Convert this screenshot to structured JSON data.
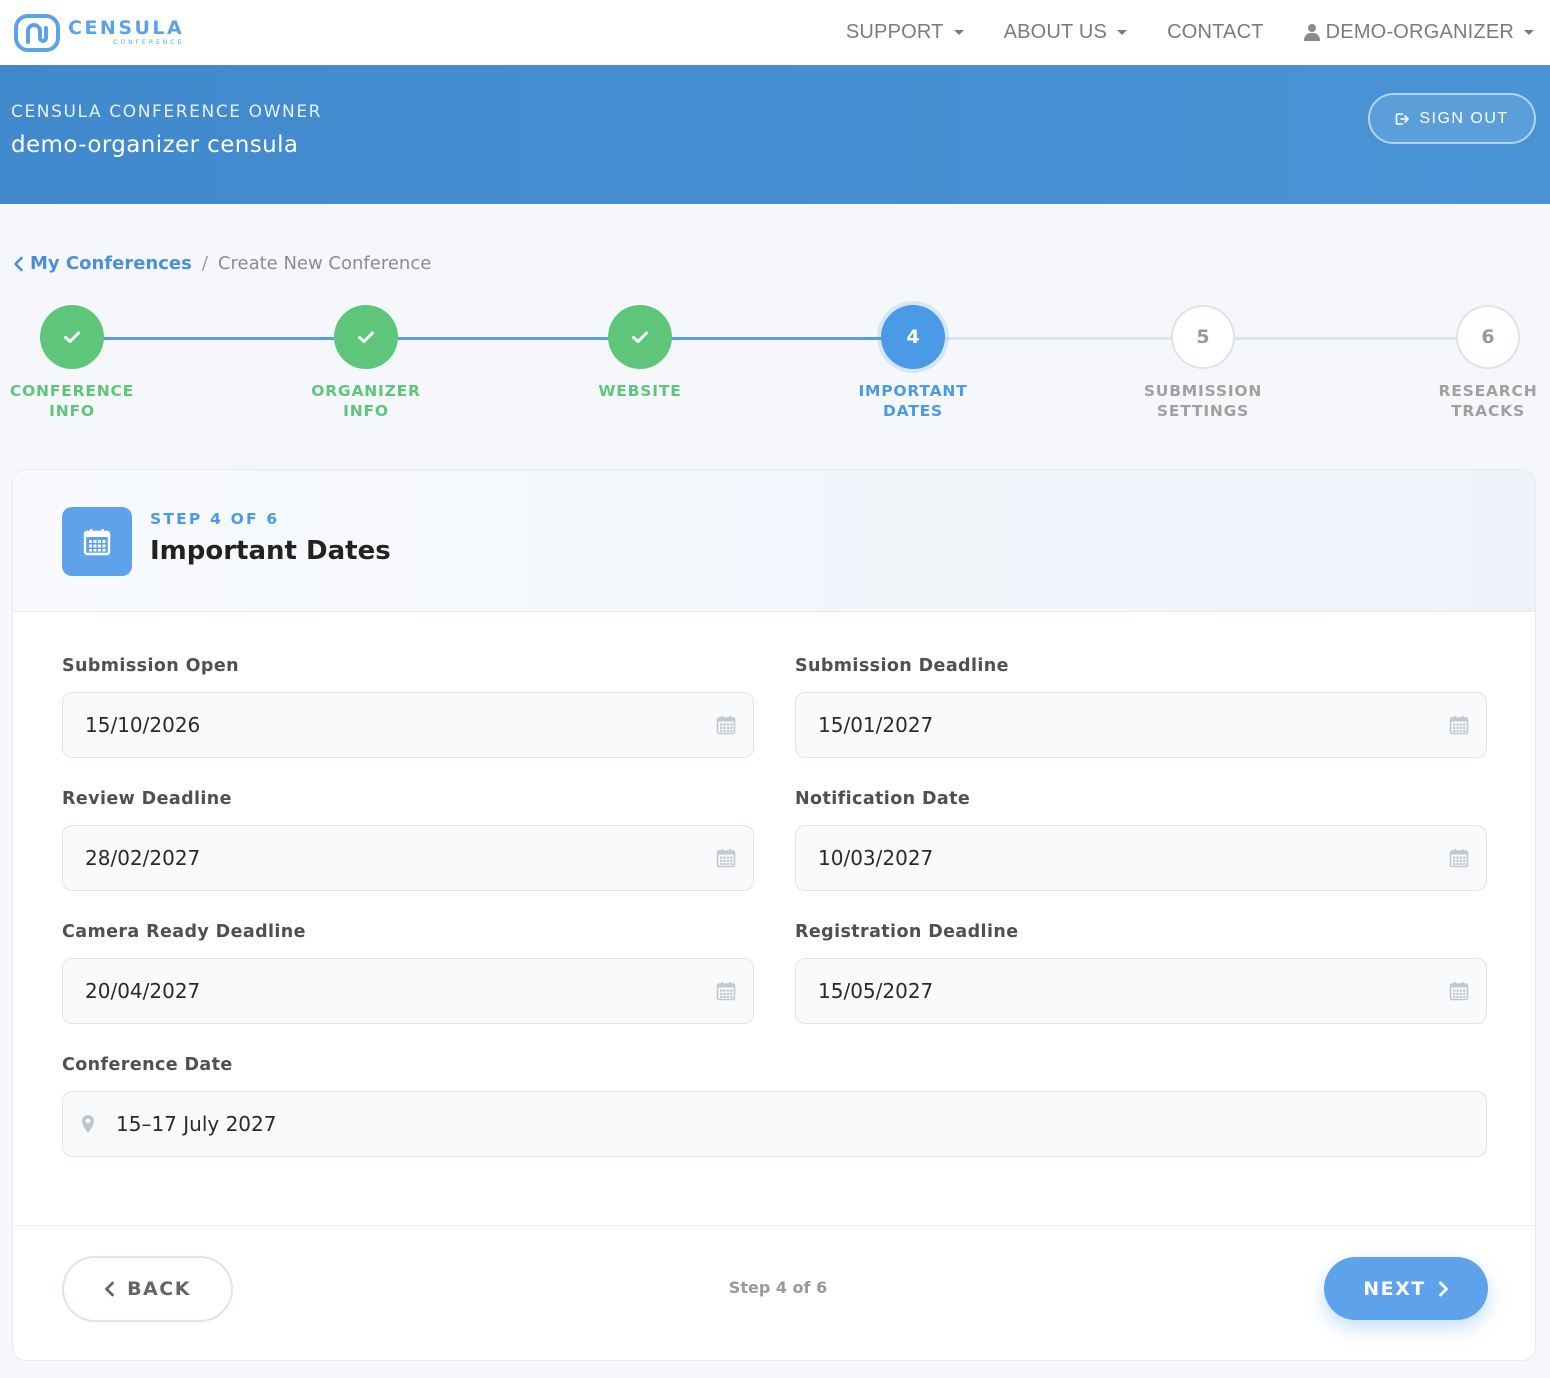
{
  "brand": {
    "name": "CENSULA",
    "tagline": "CONFERENCE",
    "logo_icon": "censula-logo-icon",
    "accent_color": "#5aa3e8"
  },
  "nav": {
    "items": [
      {
        "label": "SUPPORT",
        "has_dropdown": true
      },
      {
        "label": "ABOUT US",
        "has_dropdown": true
      },
      {
        "label": "CONTACT",
        "has_dropdown": false
      }
    ],
    "user": {
      "label": "DEMO-ORGANIZER",
      "icon": "user-icon",
      "has_dropdown": true
    }
  },
  "banner": {
    "role": "CENSULA CONFERENCE OWNER",
    "user_name": "demo-organizer censula",
    "sign_out_label": "SIGN OUT",
    "background_color": "#4189cd"
  },
  "breadcrumb": {
    "back_label": "My Conferences",
    "separator": "/",
    "current": "Create New Conference"
  },
  "stepper": {
    "current_step": 4,
    "total_steps": 6,
    "done_color": "#5ec67a",
    "active_color": "#4a9ae5",
    "steps": [
      {
        "number": "1",
        "line1": "CONFERENCE",
        "line2": "INFO",
        "state": "done"
      },
      {
        "number": "2",
        "line1": "ORGANIZER",
        "line2": "INFO",
        "state": "done"
      },
      {
        "number": "3",
        "line1": "WEBSITE",
        "line2": "",
        "state": "done"
      },
      {
        "number": "4",
        "line1": "IMPORTANT",
        "line2": "DATES",
        "state": "active"
      },
      {
        "number": "5",
        "line1": "SUBMISSION",
        "line2": "SETTINGS",
        "state": "todo"
      },
      {
        "number": "6",
        "line1": "RESEARCH",
        "line2": "TRACKS",
        "state": "todo"
      }
    ]
  },
  "card": {
    "step_label": "STEP 4 OF 6",
    "title": "Important Dates",
    "icon": "calendar-icon"
  },
  "form": {
    "submission_open": {
      "label": "Submission Open",
      "value": "15/10/2026",
      "icon": "calendar-icon"
    },
    "submission_deadline": {
      "label": "Submission Deadline",
      "value": "15/01/2027",
      "icon": "calendar-icon"
    },
    "review_deadline": {
      "label": "Review Deadline",
      "value": "28/02/2027",
      "icon": "calendar-icon"
    },
    "notification_date": {
      "label": "Notification Date",
      "value": "10/03/2027",
      "icon": "calendar-icon"
    },
    "camera_ready_deadline": {
      "label": "Camera Ready Deadline",
      "value": "20/04/2027",
      "icon": "calendar-icon"
    },
    "registration_deadline": {
      "label": "Registration Deadline",
      "value": "15/05/2027",
      "icon": "calendar-icon"
    },
    "conference_date": {
      "label": "Conference Date",
      "value": "15–17 July 2027",
      "icon": "location-pin-icon"
    }
  },
  "footer": {
    "back_label": "BACK",
    "status": "Step 4 of 6",
    "next_label": "NEXT"
  }
}
